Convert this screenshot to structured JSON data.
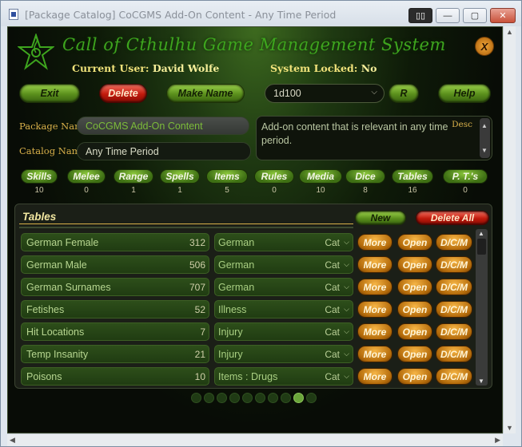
{
  "window": {
    "title": "[Package Catalog] CoCGMS Add-On Content - Any Time Period",
    "controls": {
      "restore": "▯▯",
      "minimize": "—",
      "maximize": "▢",
      "close": "✕"
    }
  },
  "header": {
    "app_title": "Call of Cthulhu Game Management System",
    "close_label": "X",
    "current_user_label": "Current User:",
    "current_user": "David Wolfe",
    "system_locked_label": "System Locked:",
    "system_locked": "No"
  },
  "toolbar": {
    "exit": "Exit",
    "delete": "Delete",
    "make_name": "Make Name",
    "dice_value": "1d100",
    "roll": "R",
    "help": "Help"
  },
  "package": {
    "package_name_label": "Package Name",
    "package_name": "CoCGMS Add-On Content",
    "catalog_name_label": "Catalog Name",
    "catalog_name": "Any Time Period",
    "desc_label": "Desc",
    "description": "Add-on content that is relevant in any time period."
  },
  "categories": [
    {
      "label": "Skills",
      "count": "10"
    },
    {
      "label": "Melee",
      "count": "0"
    },
    {
      "label": "Range",
      "count": "1"
    },
    {
      "label": "Spells",
      "count": "1"
    },
    {
      "label": "Items",
      "count": "5"
    },
    {
      "label": "Rules",
      "count": "0"
    },
    {
      "label": "Media",
      "count": "10"
    },
    {
      "label": "Dice",
      "count": "8"
    },
    {
      "label": "Tables",
      "count": "16"
    },
    {
      "label": "P. T.'s",
      "count": "0"
    }
  ],
  "tables_panel": {
    "title": "Tables",
    "new_label": "New",
    "delete_all_label": "Delete All",
    "cat_label": "Cat",
    "more_label": "More",
    "open_label": "Open",
    "dcm_label": "D/C/M",
    "rows": [
      {
        "name": "German Female",
        "count": "312",
        "category": "German"
      },
      {
        "name": "German Male",
        "count": "506",
        "category": "German"
      },
      {
        "name": "German Surnames",
        "count": "707",
        "category": "German"
      },
      {
        "name": "Fetishes",
        "count": "52",
        "category": "Illness"
      },
      {
        "name": "Hit Locations",
        "count": "7",
        "category": "Injury"
      },
      {
        "name": "Temp Insanity",
        "count": "21",
        "category": "Injury"
      },
      {
        "name": "Poisons",
        "count": "10",
        "category": "Items : Drugs"
      }
    ],
    "page_count": 10,
    "active_page": 9
  },
  "colors": {
    "accent_green": "#3ea51e",
    "label_gold": "#d8b04a",
    "button_orange": "#e08a1a",
    "button_red": "#c11a0c"
  }
}
